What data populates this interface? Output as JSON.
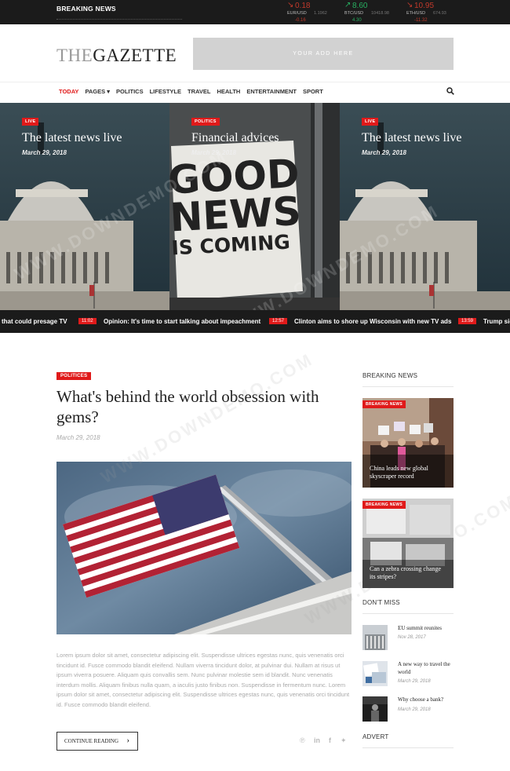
{
  "topbar": {
    "breaking_label": "BREAKING NEWS",
    "markets": [
      {
        "value": "0.18",
        "pair": "EUR/USD",
        "price": "1.1962",
        "sub": "-0.16",
        "trend": "down"
      },
      {
        "value": "8.60",
        "pair": "BTC/USD",
        "price": "10418.98",
        "sub": "4.30",
        "trend": "up"
      },
      {
        "value": "10.95",
        "pair": "ETH/USD",
        "price": "674.93",
        "sub": "-11.32",
        "trend": "down"
      }
    ],
    "colors": {
      "down": "#c0392b",
      "up": "#27ae60"
    }
  },
  "header": {
    "logo_light": "THE",
    "logo_dark": "GAZETTE",
    "ad_text": "YOUR ADD HERE"
  },
  "nav": {
    "items": [
      "TODAY",
      "PAGES ▾",
      "POLITICS",
      "LIFESTYLE",
      "TRAVEL",
      "HEALTH",
      "ENTERTAINMENT",
      "SPORT"
    ],
    "search_icon": "search-icon",
    "accent": "#e01a1a"
  },
  "hero": {
    "slides": [
      {
        "tag": "LIVE",
        "title": "The latest news live",
        "date": "March 29, 2018"
      },
      {
        "tag": "POLITICS",
        "title": "Financial advices",
        "date": "March 29, 2018",
        "sign_text": [
          "GOOD",
          "NEWS",
          "IS COMING"
        ]
      },
      {
        "tag": "LIVE",
        "title": "The latest news live",
        "date": "March 29, 2018"
      }
    ]
  },
  "ticker": {
    "items": [
      {
        "time": "",
        "text": "that could presage TV"
      },
      {
        "time": "11:02",
        "text": "Opinion: It's time to start talking about impeachment"
      },
      {
        "time": "12:57",
        "text": "Clinton aims to shore up Wisconsin with new TV ads"
      },
      {
        "time": "13:59",
        "text": "Trump sig"
      }
    ]
  },
  "article": {
    "tag": "POLITICES",
    "title": "What's behind the world obsession with gems?",
    "date": "March 29, 2018",
    "body": "Lorem ipsum dolor sit amet, consectetur adipiscing elit. Suspendisse ultrices egestas nunc, quis venenatis orci tincidunt id. Fusce commodo blandit eleifend. Nullam viverra tincidunt dolor, at pulvinar dui. Nullam at risus ut ipsum viverra posuere. Aliquam quis convallis sem. Nunc pulvinar molestie sem id blandit. Nunc venenatis interdum mollis. Aliquam finibus nulla quam, a iaculis justo finibus non. Suspendisse in fermentum nunc. Lorem ipsum dolor sit amet, consectetur adipiscing elit. Suspendisse ultrices egestas nunc, quis venenatis orci tincidunt id. Fusce commodo blandit eleifend.",
    "continue_label": "CONTINUE READING",
    "share_icons": [
      "pinterest-icon",
      "linkedin-icon",
      "facebook-icon",
      "twitter-icon"
    ]
  },
  "sidebar": {
    "breaking_heading": "BREAKING NEWS",
    "cards": [
      {
        "tag": "BREAKING NEWS",
        "title": "China leads new global skyscraper record"
      },
      {
        "tag": "BREAKING NEWS",
        "title": "Can a zebra crossing change its stripes?"
      }
    ],
    "dont_miss_heading": "DON'T MISS",
    "dont_miss": [
      {
        "title": "EU summit reunites",
        "date": "Nov 28, 2017"
      },
      {
        "title": "A new way to travel the world",
        "date": "March 29, 2018"
      },
      {
        "title": "Why choose a bank?",
        "date": "March 29, 2018"
      }
    ],
    "advert_heading": "ADVERT"
  },
  "watermark": "WWW.DOWNDEMO.COM"
}
